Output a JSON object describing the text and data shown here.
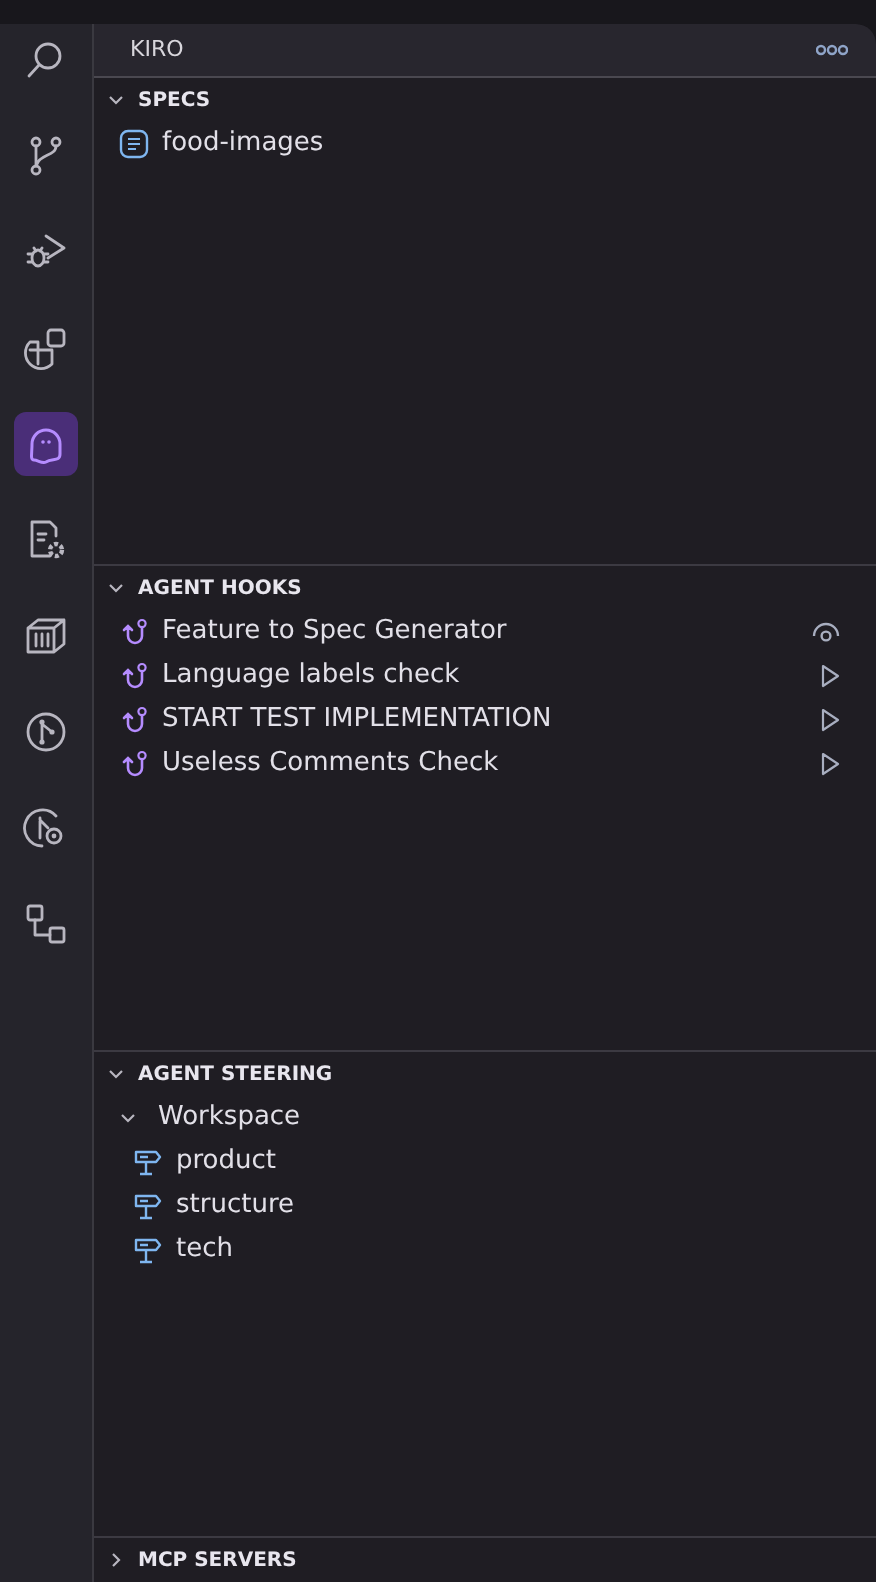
{
  "activity_bar": [
    {
      "kind": "search",
      "selected": false
    },
    {
      "kind": "branch",
      "selected": false
    },
    {
      "kind": "debug",
      "selected": false
    },
    {
      "kind": "extensions",
      "selected": false
    },
    {
      "kind": "ghost",
      "selected": true
    },
    {
      "kind": "filegear",
      "selected": false
    },
    {
      "kind": "crate",
      "selected": false
    },
    {
      "kind": "graph",
      "selected": false
    },
    {
      "kind": "graphgear",
      "selected": false
    },
    {
      "kind": "diagram",
      "selected": false
    }
  ],
  "panel": {
    "title": "KIRO"
  },
  "sections": [
    {
      "title": "SPECS",
      "expanded": true,
      "items": [
        {
          "kind": "spec",
          "label": "food-images"
        }
      ]
    },
    {
      "title": "AGENT HOOKS",
      "expanded": true,
      "items": [
        {
          "kind": "watchhook",
          "label": "Feature to Spec Generator"
        },
        {
          "kind": "runhook",
          "label": "Language labels check"
        },
        {
          "kind": "runhook",
          "label": "START TEST IMPLEMENTATION"
        },
        {
          "kind": "runhook",
          "label": "Useless Comments Check"
        }
      ]
    },
    {
      "title": "AGENT STEERING",
      "expanded": true,
      "items": [
        {
          "kind": "folder",
          "label": "Workspace",
          "expanded": true,
          "children": [
            {
              "kind": "steering",
              "label": "product"
            },
            {
              "kind": "steering",
              "label": "structure"
            },
            {
              "kind": "steering",
              "label": "tech"
            }
          ]
        }
      ]
    },
    {
      "title": "MCP SERVERS",
      "expanded": false
    }
  ]
}
